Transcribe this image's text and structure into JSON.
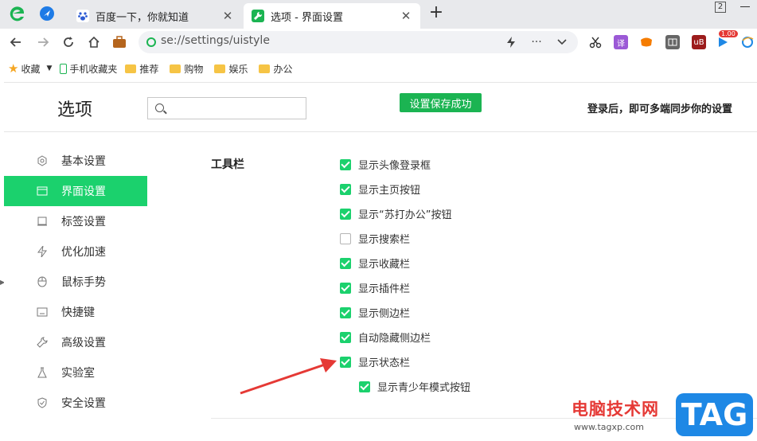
{
  "tabs": [
    {
      "title": "百度一下，你就知道",
      "close": "✕",
      "active": false
    },
    {
      "title": "选项 - 界面设置",
      "close": "✕",
      "active": true
    }
  ],
  "new_tab": "+",
  "tab_count": "2",
  "address": {
    "url": "se://settings/uistyle"
  },
  "extensions": {
    "badge": "1.00"
  },
  "bookmarks": {
    "favorites": "收藏",
    "items": [
      "手机收藏夹",
      "推荐",
      "购物",
      "娱乐",
      "办公"
    ]
  },
  "header": {
    "title": "选项",
    "search_value": "",
    "save_status": "设置保存成功",
    "sync_hint": "登录后，即可多端同步你的设置"
  },
  "sidebar": {
    "items": [
      {
        "label": "基本设置",
        "icon": "gear-icon"
      },
      {
        "label": "界面设置",
        "icon": "window-icon",
        "active": true
      },
      {
        "label": "标签设置",
        "icon": "tab-icon"
      },
      {
        "label": "优化加速",
        "icon": "lightning-icon"
      },
      {
        "label": "鼠标手势",
        "icon": "mouse-icon"
      },
      {
        "label": "快捷键",
        "icon": "keyboard-icon"
      },
      {
        "label": "高级设置",
        "icon": "wrench-icon"
      },
      {
        "label": "实验室",
        "icon": "flask-icon"
      },
      {
        "label": "安全设置",
        "icon": "shield-icon"
      }
    ]
  },
  "toolbar_section": {
    "label": "工具栏",
    "options": [
      {
        "label": "显示头像登录框",
        "checked": true
      },
      {
        "label": "显示主页按钮",
        "checked": true
      },
      {
        "label": "显示“苏打办公”按钮",
        "checked": true
      },
      {
        "label": "显示搜索栏",
        "checked": false
      },
      {
        "label": "显示收藏栏",
        "checked": true
      },
      {
        "label": "显示插件栏",
        "checked": true
      },
      {
        "label": "显示侧边栏",
        "checked": true
      },
      {
        "label": "自动隐藏侧边栏",
        "checked": true
      },
      {
        "label": "显示状态栏",
        "checked": true
      },
      {
        "label": "显示青少年模式按钮",
        "checked": true,
        "nested": true
      }
    ]
  },
  "watermark": {
    "cn": "电脑技术网",
    "url": "www.tagxp.com",
    "tag": "TAG"
  },
  "colors": {
    "accent": "#1bd16d",
    "save_toast": "#1bb452",
    "arrow": "#e53935",
    "tag": "#1e88e5"
  }
}
